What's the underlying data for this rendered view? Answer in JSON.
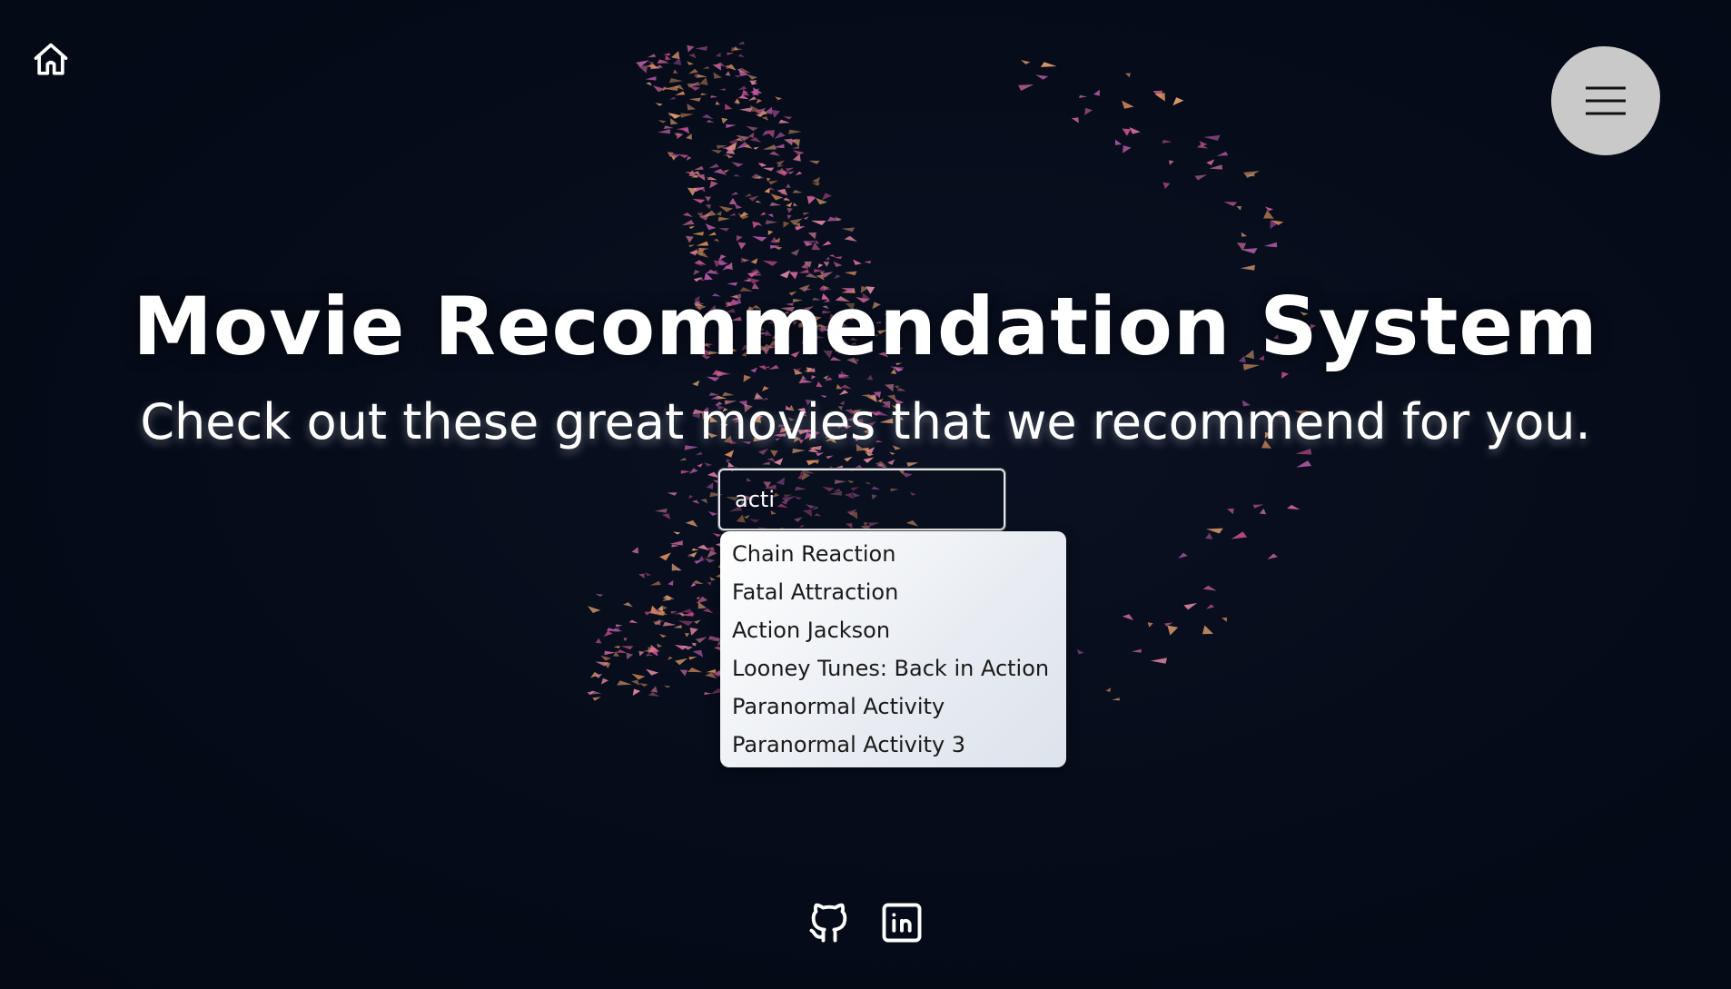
{
  "header": {
    "home_icon": "home-icon",
    "menu_icon": "hamburger-menu-icon"
  },
  "hero": {
    "title": "Movie Recommendation System",
    "subtitle": "Check out these great movies that we recommend for you."
  },
  "search": {
    "value": "acti",
    "suggestions": [
      "Chain Reaction",
      "Fatal Attraction",
      "Action Jackson",
      "Looney Tunes: Back in Action",
      "Paranormal Activity",
      "Paranormal Activity 3"
    ]
  },
  "footer": {
    "links": [
      "github-icon",
      "linkedin-icon"
    ]
  },
  "colors": {
    "background": "#050b18",
    "menu_button": "#c9c9c9",
    "text": "#ffffff",
    "particle_pink": "#d86aa0",
    "particle_orange": "#d98c5a"
  }
}
